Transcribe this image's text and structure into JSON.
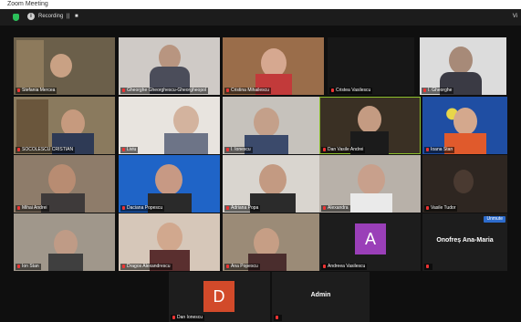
{
  "window": {
    "title": "Zoom Meeting"
  },
  "topbar": {
    "recording_label": "Recording",
    "pause_glyph": "||",
    "stop_glyph": "■",
    "view_label": "Vi"
  },
  "colors": {
    "avatar_a": "#9a3fb8",
    "avatar_d": "#d24a2a",
    "speaker_border": "#8bbf2c"
  },
  "participants": [
    {
      "name": "Stefania Mercea",
      "mic_muted": true
    },
    {
      "name": "Gheorghe Gheorghescu-Gheorgheopol",
      "mic_muted": true
    },
    {
      "name": "Cristina Mihailescu",
      "mic_muted": true
    },
    {
      "name": "Cristea Vasilescu",
      "mic_muted": true
    },
    {
      "name": "I. Gheorghe",
      "mic_muted": true
    },
    {
      "name": "SOCOLESCU CRISTIAN",
      "mic_muted": true
    },
    {
      "name": "Liviu",
      "mic_muted": false
    },
    {
      "name": "I. Ionescu",
      "mic_muted": true
    },
    {
      "name": "Dan Vasile Andrei",
      "mic_muted": true
    },
    {
      "name": "Ioana Stan",
      "mic_muted": true
    },
    {
      "name": "Mihai Andrei",
      "mic_muted": true
    },
    {
      "name": "Daciana Popescu",
      "mic_muted": true
    },
    {
      "name": "Adriana Popa",
      "mic_muted": true
    },
    {
      "name": "Alexandra",
      "mic_muted": true
    },
    {
      "name": "Vasile Tudor",
      "mic_muted": true
    },
    {
      "name": "Ion Stan",
      "mic_muted": true
    },
    {
      "name": "Dragos Alexandrescu",
      "mic_muted": true
    },
    {
      "name": "Ana Popescu",
      "mic_muted": true
    },
    {
      "name": "Andreea Vasilescu",
      "mic_muted": true,
      "avatar_letter": "A"
    },
    {
      "name": "Onofreș Ana-Maria",
      "mic_muted": true,
      "display_name": "Onofreș Ana-Maria"
    },
    {
      "name": "Dan Ionescu",
      "mic_muted": true,
      "avatar_letter": "D"
    },
    {
      "name": "Admin",
      "mic_muted": true,
      "display_name": "Admin"
    }
  ],
  "unmute_badge": "Unmute"
}
